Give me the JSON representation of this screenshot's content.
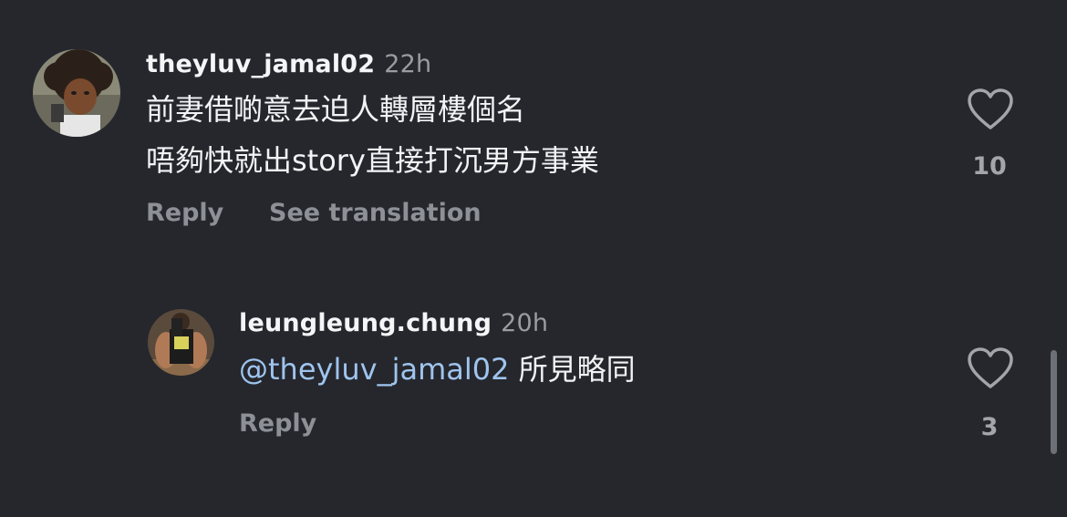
{
  "comments": [
    {
      "username": "theyluv_jamal02",
      "timestamp": "22h",
      "text_lines": [
        "前妻借啲意去迫人轉層樓個名",
        "唔夠快就出story直接打沉男方事業"
      ],
      "reply_label": "Reply",
      "translate_label": "See translation",
      "like_count": "10"
    }
  ],
  "replies": [
    {
      "username": "leungleung.chung",
      "timestamp": "20h",
      "mention": "@theyluv_jamal02",
      "text": " 所見略同",
      "reply_label": "Reply",
      "like_count": "3"
    }
  ],
  "icons": {
    "like": "heart-outline-icon"
  },
  "colors": {
    "background": "#25272d",
    "mention": "#9fc4ee",
    "secondary_text": "#8e9097"
  }
}
